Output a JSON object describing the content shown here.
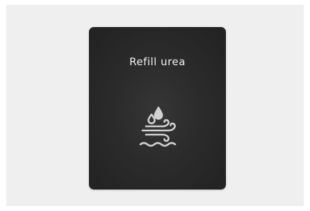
{
  "warning": {
    "title": "Refill urea",
    "icon": "urea-refill-icon",
    "text_color": "#f2f2f2",
    "icon_color": "#d2d2d2",
    "display_color": "#2b2b2b",
    "background_color": "#efefef"
  }
}
